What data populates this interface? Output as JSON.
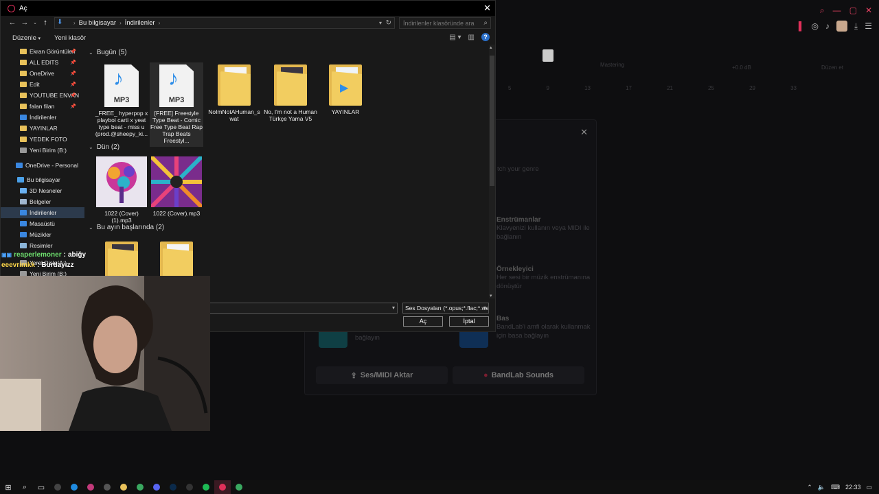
{
  "dialog": {
    "title": "Aç",
    "breadcrumb": [
      "Bu bilgisayar",
      "İndirilenler"
    ],
    "search_placeholder": "İndirilenler klasöründe ara",
    "commands": {
      "organize": "Düzenle",
      "new_folder": "Yeni klasör"
    },
    "nav_items": [
      {
        "label": "Ekran Görüntüleri",
        "icon": "folder-icon",
        "pinned": true
      },
      {
        "label": "ALL EDITS",
        "icon": "folder-icon",
        "pinned": true
      },
      {
        "label": "OneDrive",
        "icon": "folder-icon",
        "pinned": true
      },
      {
        "label": "Edit",
        "icon": "folder-icon",
        "pinned": true
      },
      {
        "label": "YOUTUBE ENVAN",
        "icon": "folder-icon",
        "pinned": true
      },
      {
        "label": "falan filan",
        "icon": "folder-icon",
        "pinned": true
      },
      {
        "label": "İndirilenler",
        "icon": "download-icon",
        "pinned": false
      },
      {
        "label": "YAYINLAR",
        "icon": "folder-icon",
        "pinned": false
      },
      {
        "label": "YEDEK FOTO",
        "icon": "folder-icon",
        "pinned": false
      },
      {
        "label": "Yeni Birim (B:)",
        "icon": "drive-icon",
        "pinned": false
      },
      {
        "label": "OneDrive - Personal",
        "icon": "cloud-icon",
        "pinned": false
      },
      {
        "label": "Bu bilgisayar",
        "icon": "computer-icon",
        "pinned": false
      },
      {
        "label": "3D Nesneler",
        "icon": "cube-icon",
        "pinned": false
      },
      {
        "label": "Belgeler",
        "icon": "documents-icon",
        "pinned": false
      },
      {
        "label": "İndirilenler",
        "icon": "download-icon",
        "pinned": false,
        "selected": true
      },
      {
        "label": "Masaüstü",
        "icon": "desktop-icon",
        "pinned": false
      },
      {
        "label": "Müzikler",
        "icon": "music-icon",
        "pinned": false
      },
      {
        "label": "Resimler",
        "icon": "pictures-icon",
        "pinned": false
      },
      {
        "label": "Yerel Disk (A:)",
        "icon": "drive-icon",
        "pinned": false
      },
      {
        "label": "Yeni Birim (B:)",
        "icon": "drive-icon",
        "pinned": false
      }
    ],
    "groups": [
      {
        "title": "Bugün (5)",
        "items": [
          {
            "label": "_FREE_ hyperpop x playboi carti x yeat type beat - miss u (prod.@sheepy_ki...",
            "type": "mp3"
          },
          {
            "label": "[FREE] Freestyle Type Beat - Comic Free Type Beat  Rap Trap Beats Freestyl...",
            "type": "mp3",
            "hover": true
          },
          {
            "label": "NoImNotAHuman_swat",
            "type": "folder"
          },
          {
            "label": "No, I'm not a Human Türkçe Yama V5",
            "type": "folder-image"
          },
          {
            "label": "YAYINLAR",
            "type": "folder-video"
          }
        ]
      },
      {
        "title": "Dün (2)",
        "items": [
          {
            "label": "1022 (Cover) (1).mp3",
            "type": "cover-tree"
          },
          {
            "label": "1022 (Cover).mp3",
            "type": "cover-burst"
          }
        ]
      },
      {
        "title": "Bu ayın başlarında (2)",
        "items": [
          {
            "label": "",
            "type": "folder-image"
          },
          {
            "label": "",
            "type": "folder"
          }
        ]
      }
    ],
    "mp3_badge": "MP3",
    "filename_value": "",
    "filetype": "Ses Dosyaları (*.opus;*.flac;*.we",
    "open_button": "Aç",
    "cancel_button": "İptal"
  },
  "background_app": {
    "modal_placeholder": "tch your genre",
    "options": [
      {
        "title": "Enstrümanlar",
        "desc": "Klavyenizi kullanın veya MIDI ile bağlanın"
      },
      {
        "title": "Örnekleyici",
        "desc": "Her sesi bir müzik enstrümanına dönüştür"
      },
      {
        "title": "Bas",
        "desc": "BandLab'i amfi olarak kullanmak için basa bağlayın"
      }
    ],
    "guitar_desc": "kullanmak için gitara bağlayın",
    "import_button": "Ses/MIDI Aktar",
    "sounds_button": "BandLab Sounds",
    "track_label": "Mastering",
    "db_readout": "+0.0 dB",
    "preset_label": "Düzen et",
    "ruler": [
      "5",
      "9",
      "13",
      "17",
      "21",
      "25",
      "29",
      "33"
    ]
  },
  "chat": [
    {
      "user": "reaperlemoner",
      "text": "abiğy"
    },
    {
      "user": "eeevrimkk",
      "text": "Burdayızz"
    }
  ],
  "taskbar": {
    "time": "22:33",
    "apps": [
      "start-icon",
      "search-icon",
      "task-view-icon",
      "obs-icon",
      "edge-icon",
      "app-icon",
      "calculator-icon",
      "explorer-icon",
      "chrome-icon",
      "discord-icon",
      "photoshop-icon",
      "steam-icon",
      "spotify-icon",
      "bandlab-icon",
      "chrome-icon"
    ]
  },
  "colors": {
    "accent_red": "#e0305a",
    "folder": "#e8c15a",
    "selected": "#2c3a4c",
    "help": "#2a6fc9"
  }
}
